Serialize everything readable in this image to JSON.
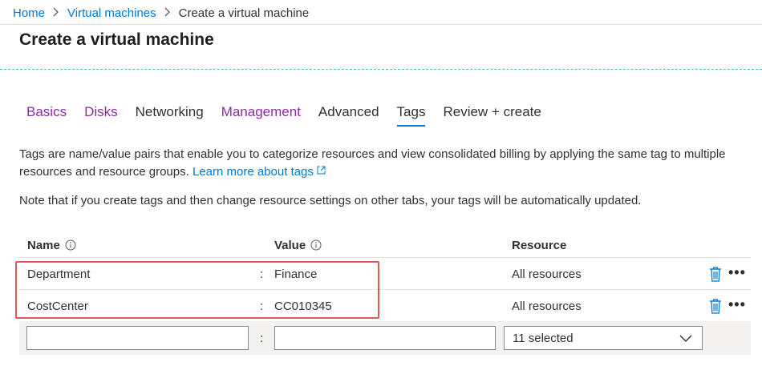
{
  "breadcrumb": {
    "items": [
      "Home",
      "Virtual machines"
    ],
    "current": "Create a virtual machine"
  },
  "page": {
    "title": "Create a virtual machine"
  },
  "tabs": [
    {
      "label": "Basics",
      "state": "visited"
    },
    {
      "label": "Disks",
      "state": "visited"
    },
    {
      "label": "Networking",
      "state": "plain"
    },
    {
      "label": "Management",
      "state": "visited"
    },
    {
      "label": "Advanced",
      "state": "plain"
    },
    {
      "label": "Tags",
      "state": "active"
    },
    {
      "label": "Review + create",
      "state": "plain"
    }
  ],
  "description": {
    "text": "Tags are name/value pairs that enable you to categorize resources and view consolidated billing by applying the same tag to multiple resources and resource groups.",
    "link": "Learn more about tags"
  },
  "note": "Note that if you create tags and then change resource settings on other tabs, your tags will be automatically updated.",
  "table": {
    "headers": {
      "name": "Name",
      "value": "Value",
      "resource": "Resource"
    },
    "separator": ":",
    "rows": [
      {
        "name": "Department",
        "value": "Finance",
        "resource": "All resources"
      },
      {
        "name": "CostCenter",
        "value": "CC010345",
        "resource": "All resources"
      }
    ],
    "more_label": "•••",
    "new_row": {
      "name_value": "",
      "value_value": "",
      "resource_selected": "11 selected"
    }
  },
  "colors": {
    "link": "#0078d4",
    "visited_tab": "#8a2da5",
    "highlight_border": "#e05a5a",
    "icon_blue": "#0078d4"
  }
}
